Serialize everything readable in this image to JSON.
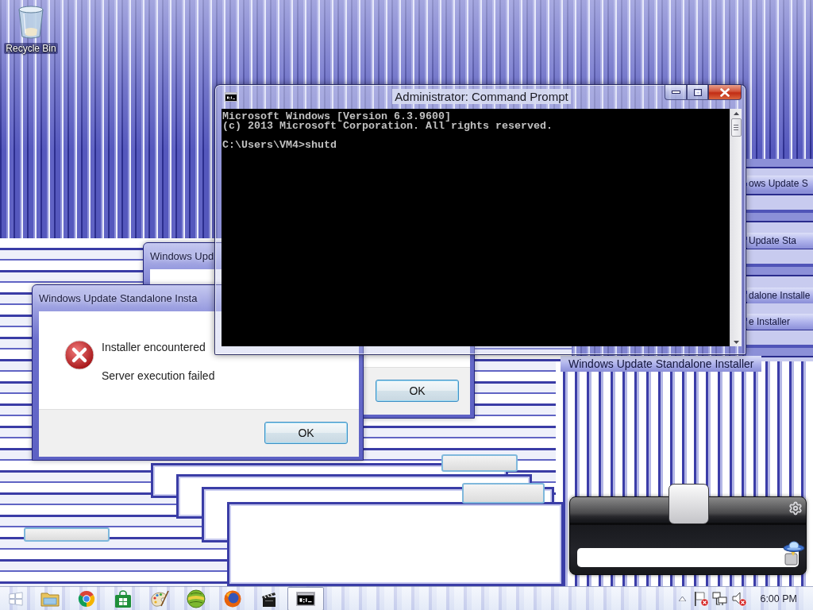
{
  "desktop_icons": [
    {
      "label": "Recycle Bin"
    }
  ],
  "trail_titles": [
    "ows Update S",
    "Update Sta",
    "dalone Installe",
    "e Installer",
    "Windows Update Standalone Installer"
  ],
  "dialogs": [
    {
      "title": "Windows Upd",
      "button": "OK"
    },
    {
      "title": "Windows Update Standalone Insta",
      "messages": [
        "Installer encountered",
        "Server execution failed"
      ],
      "button": "OK"
    }
  ],
  "console_window": {
    "title": "Administrator: Command Prompt",
    "output_lines": [
      "Microsoft Windows [Version 6.3.9600]",
      "(c) 2013 Microsoft Corporation. All rights reserved."
    ],
    "prompt_line": "C:\\Users\\VM4>shutd"
  },
  "gadget": {
    "slider": {
      "level": 0.5
    }
  },
  "taskbar": {
    "buttons": [
      {
        "kind": "start",
        "selected": false
      },
      {
        "kind": "folder",
        "selected": false
      },
      {
        "kind": "ball",
        "selected": false
      },
      {
        "kind": "bag",
        "selected": false
      },
      {
        "kind": "palette",
        "selected": false
      },
      {
        "kind": "globe",
        "selected": false
      },
      {
        "kind": "ringed",
        "selected": false
      },
      {
        "kind": "clapper",
        "selected": false
      },
      {
        "kind": "console",
        "selected": true
      }
    ],
    "tray": [
      {
        "kind": "chevron",
        "alert": false
      },
      {
        "kind": "flag",
        "alert": true
      },
      {
        "kind": "network",
        "alert": false
      },
      {
        "kind": "speaker",
        "alert": true
      }
    ],
    "clock": "6:00 PM"
  }
}
